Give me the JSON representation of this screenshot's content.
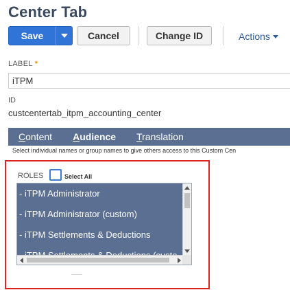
{
  "page": {
    "title": "Center Tab"
  },
  "toolbar": {
    "save_label": "Save",
    "cancel_label": "Cancel",
    "change_id_label": "Change ID",
    "actions_label": "Actions"
  },
  "form": {
    "label_caption": "LABEL",
    "required_mark": "*",
    "label_value": "iTPM",
    "id_caption": "ID",
    "id_value": "custcentertab_itpm_accounting_center"
  },
  "tabs": [
    {
      "label_underlined": "C",
      "label_rest": "ontent",
      "active": false
    },
    {
      "label_underlined": "A",
      "label_rest": "udience",
      "active": true
    },
    {
      "label_underlined": "T",
      "label_rest": "ranslation",
      "active": false
    }
  ],
  "audience": {
    "hint": "Select individual names or group names to give others access to this Custom Cen",
    "roles_label": "ROLES",
    "select_all_label": "Select All",
    "select_all_checked": false,
    "roles": [
      "- iTPM Administrator",
      "- iTPM Administrator (custom)",
      "- iTPM Settlements & Deductions",
      "- iTPM Settlements & Deductions (custo"
    ]
  },
  "colors": {
    "primary_button": "#2f74d6",
    "tab_bar": "#5a6f91",
    "highlight_border": "#dd2222",
    "link": "#2b5d9e"
  }
}
